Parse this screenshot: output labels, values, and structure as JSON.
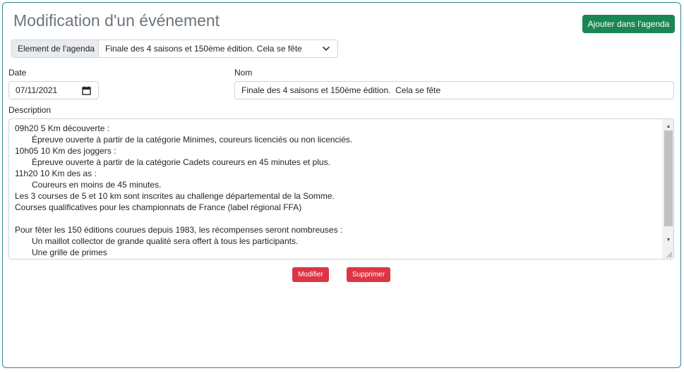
{
  "page": {
    "title": "Modification d'un événement",
    "add_button": "Ajouter dans l'agenda"
  },
  "agenda": {
    "label": "Element de l'agenda",
    "selected": "Finale des 4 saisons et 150ème édition. Cela se fête"
  },
  "form": {
    "date_label": "Date",
    "date_value": "07/11/2021",
    "name_label": "Nom",
    "name_value": "Finale des 4 saisons et 150ème édition.  Cela se fête",
    "description_label": "Description",
    "description_lines": [
      "09h20 5 Km découverte :",
      "Épreuve ouverte à partir de la catégorie Minimes, coureurs licenciés ou non licenciés.",
      "10h05 10 Km des joggers :",
      "Épreuve ouverte à partir de la catégorie Cadets coureurs en 45 minutes et plus.",
      "11h20 10 Km des as :",
      "Coureurs en moins de 45 minutes.",
      "Les 3 courses de 5 et 10 km sont inscrites au challenge départemental de la Somme.",
      "Courses qualificatives pour les championnats de France (label régional FFA)",
      "",
      "Pour fêter les 150 éditions courues depuis 1983, les récompenses seront nombreuses :",
      "Un maillot collector de grande qualité sera offert à tous les participants.",
      "Une grille de primes"
    ]
  },
  "actions": {
    "modify": "Modifier",
    "delete": "Supprimer"
  },
  "colors": {
    "success": "#198754",
    "danger": "#dc3545",
    "frame_border": "#2e8b8b",
    "title": "#6c757d"
  },
  "icons": {
    "select_chevron": "chevron-down-icon",
    "date_picker": "calendar-icon"
  }
}
